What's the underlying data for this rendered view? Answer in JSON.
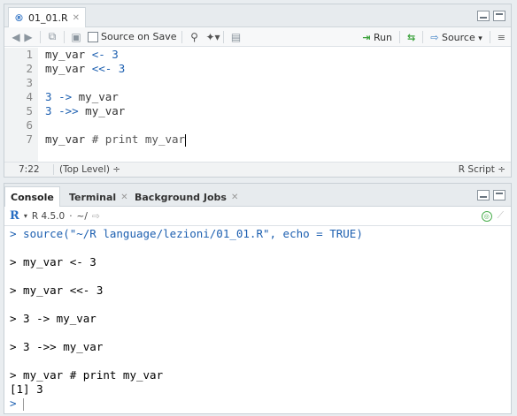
{
  "editor": {
    "tab_label": "01_01.R",
    "toolbar": {
      "source_on_save": "Source on Save",
      "run": "Run",
      "source": "Source"
    },
    "line_numbers": [
      "1",
      "2",
      "3",
      "4",
      "5",
      "6",
      "7"
    ],
    "status": {
      "position": "7:22",
      "scope": "(Top Level) ÷",
      "file_type": "R Script ÷"
    }
  },
  "console": {
    "tabs": [
      "Console",
      "Terminal",
      "Background Jobs"
    ],
    "r_version": "R 4.5.0",
    "path": "~/",
    "lines": {
      "l1": "> source(\"~/R language/lezioni/01_01.R\", echo = TRUE)",
      "l3": "> my_var <- 3",
      "l5": "> my_var <<- 3",
      "l7": "> 3 -> my_var",
      "l9": "> 3 ->> my_var",
      "l11": "> my_var # print my_var",
      "l12": "[1] 3",
      "l13": ">"
    }
  },
  "icons": [
    "r-file-icon",
    "back-icon",
    "forward-icon",
    "show-in-window-icon",
    "save-icon",
    "search-icon",
    "magic-wand-icon",
    "compile-report-icon",
    "run-icon",
    "rerun-icon",
    "source-icon",
    "outline-icon",
    "r-logo-icon",
    "clear-console-icon",
    "broom-icon"
  ],
  "colors": {
    "code_keyword": "#1c5fb0",
    "console_prompt": "#1c5fb0",
    "run_green": "#3aa13a"
  }
}
